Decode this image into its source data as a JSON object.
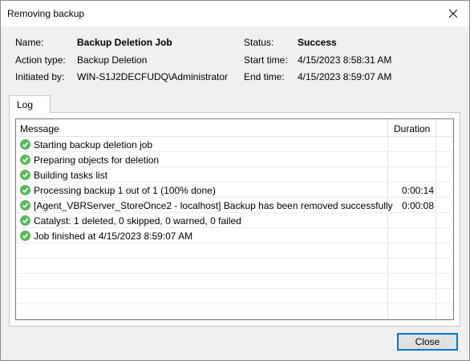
{
  "window": {
    "title": "Removing backup",
    "close_icon": "close-icon"
  },
  "info": {
    "name_label": "Name:",
    "name_value": "Backup Deletion Job",
    "action_label": "Action type:",
    "action_value": "Backup Deletion",
    "initiated_label": "Initiated by:",
    "initiated_value": "WIN-S1J2DECFUDQ\\Administrator",
    "status_label": "Status:",
    "status_value": "Success",
    "start_label": "Start time:",
    "start_value": "4/15/2023 8:58:31 AM",
    "end_label": "End time:",
    "end_value": "4/15/2023 8:59:07 AM"
  },
  "tabs": [
    {
      "label": "Log"
    }
  ],
  "log": {
    "columns": {
      "message": "Message",
      "duration": "Duration"
    },
    "rows": [
      {
        "message": "Starting backup deletion job",
        "duration": "",
        "icon": "success-icon"
      },
      {
        "message": "Preparing objects for deletion",
        "duration": "",
        "icon": "success-icon"
      },
      {
        "message": "Building tasks list",
        "duration": "",
        "icon": "success-icon"
      },
      {
        "message": "Processing backup 1 out of 1 (100% done)",
        "duration": "0:00:14",
        "icon": "success-icon"
      },
      {
        "message": "[Agent_VBRServer_StoreOnce2 - localhost] Backup has been removed successfully",
        "duration": "0:00:08",
        "icon": "success-icon"
      },
      {
        "message": "Catalyst: 1 deleted, 0 skipped, 0 warned, 0 failed",
        "duration": "",
        "icon": "success-icon"
      },
      {
        "message": "Job finished at 4/15/2023 8:59:07 AM",
        "duration": "",
        "icon": "success-icon"
      }
    ]
  },
  "buttons": {
    "close": "Close"
  },
  "colors": {
    "success": "#5cb85c",
    "focus": "#0078d7"
  }
}
